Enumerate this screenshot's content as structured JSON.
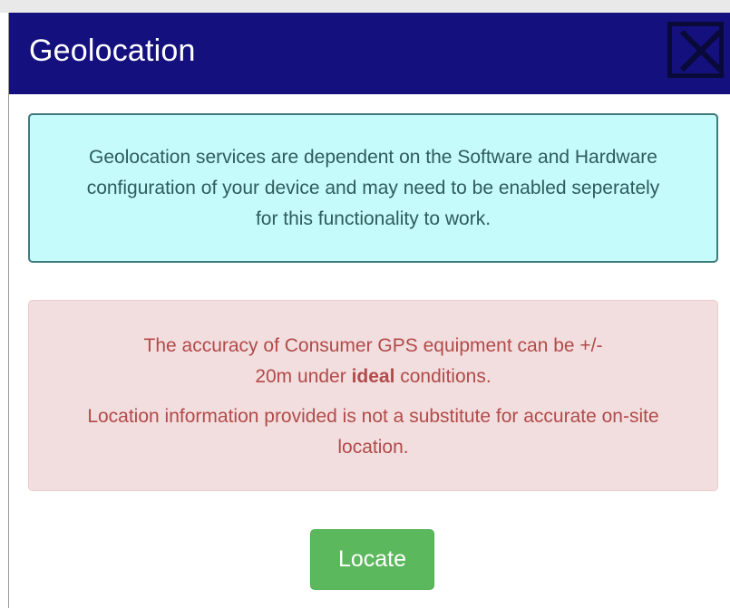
{
  "dialog": {
    "title": "Geolocation",
    "close_icon": "close-x-icon"
  },
  "info_alert": {
    "text": "Geolocation services are dependent on the Software and Hardware configuration of your device and may need to be enabled seperately for this functionality to work."
  },
  "warning_alert": {
    "line1_before": "The accuracy of Consumer GPS equipment can be +/- 20m under ",
    "line1_bold": "ideal",
    "line1_after": " conditions.",
    "line2": "Location information provided is not a substitute for accurate on-site location."
  },
  "actions": {
    "locate_label": "Locate"
  },
  "colors": {
    "titlebar": "#14117f",
    "info_background": "#c5fcfb",
    "info_border": "#3f7a7d",
    "warning_background": "#f2dede",
    "warning_text": "#b24a4a",
    "locate_button": "#5cb85c"
  }
}
